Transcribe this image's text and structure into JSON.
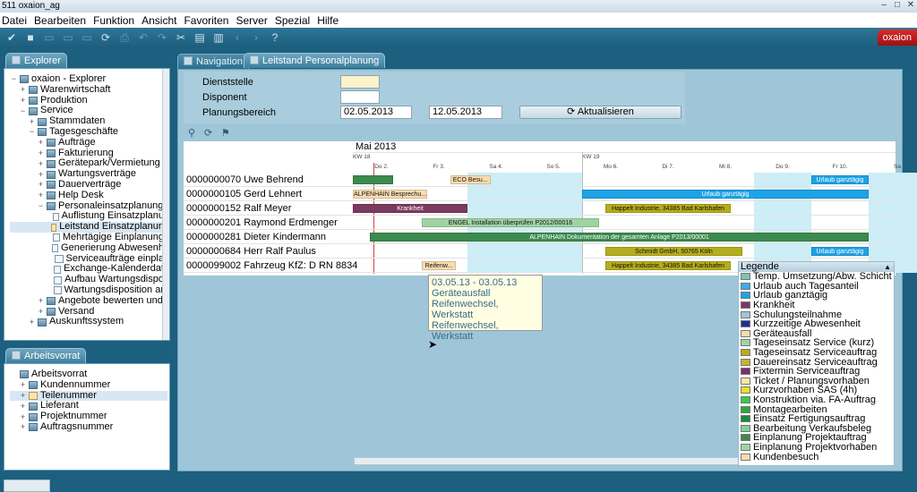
{
  "window": {
    "title": "511 oxaion_ag"
  },
  "menu": [
    "Datei",
    "Bearbeiten",
    "Funktion",
    "Ansicht",
    "Favoriten",
    "Server",
    "Spezial",
    "Hilfe"
  ],
  "brand": "oxaion",
  "explorer": {
    "tab": "Explorer",
    "items": [
      {
        "label": "oxaion - Explorer",
        "level": 0,
        "exp": "-"
      },
      {
        "label": "Warenwirtschaft",
        "level": 1,
        "exp": "+"
      },
      {
        "label": "Produktion",
        "level": 1,
        "exp": "+"
      },
      {
        "label": "Service",
        "level": 1,
        "exp": "-"
      },
      {
        "label": "Stammdaten",
        "level": 2,
        "exp": "+"
      },
      {
        "label": "Tagesgeschäfte",
        "level": 2,
        "exp": "-"
      },
      {
        "label": "Aufträge",
        "level": 3,
        "exp": "+"
      },
      {
        "label": "Fakturierung",
        "level": 3,
        "exp": "+"
      },
      {
        "label": "Gerätepark/Vermietung",
        "level": 3,
        "exp": "+"
      },
      {
        "label": "Wartungsverträge",
        "level": 3,
        "exp": "+"
      },
      {
        "label": "Dauerverträge",
        "level": 3,
        "exp": "+"
      },
      {
        "label": "Help Desk",
        "level": 3,
        "exp": "+"
      },
      {
        "label": "Personaleinsatzplanung",
        "level": 3,
        "exp": "-"
      },
      {
        "label": "Auflistung Einsatzplanu",
        "level": 4,
        "exp": ""
      },
      {
        "label": "Leitstand Einsatzplanun",
        "level": 4,
        "exp": "",
        "selected": true
      },
      {
        "label": "Mehrtägige Einplanung",
        "level": 4,
        "exp": ""
      },
      {
        "label": "Generierung Abwesenh",
        "level": 4,
        "exp": ""
      },
      {
        "label": "Serviceaufträge einpla",
        "level": 4,
        "exp": ""
      },
      {
        "label": "Exchange-Kalenderdat",
        "level": 4,
        "exp": ""
      },
      {
        "label": "Aufbau Wartungsdispo",
        "level": 4,
        "exp": ""
      },
      {
        "label": "Wartungsdisposition ar",
        "level": 4,
        "exp": ""
      },
      {
        "label": "Angebote bewerten und",
        "level": 3,
        "exp": "+"
      },
      {
        "label": "Versand",
        "level": 3,
        "exp": "+"
      },
      {
        "label": "Auskunftssystem",
        "level": 2,
        "exp": "+"
      }
    ]
  },
  "arbeitsvorrat": {
    "tab": "Arbeitsvorrat",
    "items": [
      {
        "label": "Arbeitsvorrat",
        "level": 0,
        "exp": ""
      },
      {
        "label": "Kundennummer",
        "level": 1,
        "exp": "+"
      },
      {
        "label": "Teilenummer",
        "level": 1,
        "exp": "+",
        "selected": true
      },
      {
        "label": "Lieferant",
        "level": 1,
        "exp": "+"
      },
      {
        "label": "Projektnummer",
        "level": 1,
        "exp": "+"
      },
      {
        "label": "Auftragsnummer",
        "level": 1,
        "exp": "+"
      }
    ]
  },
  "tabs": {
    "navigation": "Navigation",
    "leitstand": "Leitstand Personalplanung"
  },
  "form": {
    "dienststelle_label": "Dienststelle",
    "disponent_label": "Disponent",
    "planungsbereich_label": "Planungsbereich",
    "date_from": "02.05.2013",
    "date_to": "12.05.2013",
    "refresh_button": "Aktualisieren"
  },
  "chart_data": {
    "type": "gantt",
    "month": "Mai 2013",
    "weeks": [
      "KW 18",
      "KW 19"
    ],
    "days": [
      "Do 2.",
      "Fr 3.",
      "Sa 4.",
      "So 5.",
      "Mo 6.",
      "Di 7.",
      "Mi 8.",
      "Do 9.",
      "Fr 10.",
      "Sa"
    ],
    "rows": [
      {
        "label": "0000000070 Uwe Behrend",
        "bars": [
          {
            "start": 0,
            "end": 0.7,
            "color": "#3c8a4d",
            "text": ""
          },
          {
            "start": 1.7,
            "end": 2.4,
            "color": "#f9dcb0",
            "text": "ECO  Besu..."
          },
          {
            "start": 8,
            "end": 9,
            "color": "#1ea3e6",
            "text": "Urlaub ganztägig"
          }
        ]
      },
      {
        "label": "0000000105 Gerd Lehnert",
        "bars": [
          {
            "start": 0,
            "end": 1.3,
            "color": "#f9dcb0",
            "text": "ALPENHAIN  Besprechu..."
          },
          {
            "start": 4,
            "end": 9,
            "color": "#1ea3e6",
            "text": "Urlaub ganztägig"
          }
        ]
      },
      {
        "label": "0000000152 Ralf Meyer",
        "bars": [
          {
            "start": 0,
            "end": 2,
            "color": "#7b3a60",
            "text": "Krankheit"
          },
          {
            "start": 4.4,
            "end": 6.6,
            "color": "#b5ae1c",
            "text": "Happelt Industrie, 34385 Bad Karlshafen"
          }
        ]
      },
      {
        "label": "0000000201 Raymond Erdmenger",
        "bars": [
          {
            "start": 1.2,
            "end": 4.3,
            "color": "#9fd4a2",
            "text": "ENGEL  Installation überprüfen P2012/00016"
          }
        ]
      },
      {
        "label": "0000000281 Dieter Kindermann",
        "bars": [
          {
            "start": 0.3,
            "end": 9,
            "color": "#3c8a4d",
            "text": "ALPENHAIN  Dokumentation der gesamten Anlage P2013/00001"
          }
        ]
      },
      {
        "label": "0000000684 Herr Ralf Paulus",
        "bars": [
          {
            "start": 4.4,
            "end": 6.8,
            "color": "#b5ae1c",
            "text": "Schmidt GmbH, 50765 Köln"
          },
          {
            "start": 8,
            "end": 9,
            "color": "#1ea3e6",
            "text": "Urlaub ganztägig"
          }
        ]
      },
      {
        "label": "0000099002 Fahrzeug KfZ: D RN 8834",
        "bars": [
          {
            "start": 1.2,
            "end": 1.8,
            "color": "#f9dcb0",
            "text": "Reifenw..."
          },
          {
            "start": 4.4,
            "end": 6.6,
            "color": "#b5ae1c",
            "text": "Happelt Industrie, 34385 Bad Karlshafen"
          }
        ]
      }
    ]
  },
  "tooltip": [
    "03.05.13 - 03.05.13",
    "Geräteausfall",
    "Reifenwechsel, Werkstatt",
    "",
    "Reifenwechsel, Werkstatt"
  ],
  "legend": {
    "title": "Legende",
    "items": [
      {
        "label": "Temp. Umsetzung/Abw. Schicht",
        "color": "#7fc4b2"
      },
      {
        "label": "Urlaub auch Tagesanteil",
        "color": "#3aaee8"
      },
      {
        "label": "Urlaub ganztägig",
        "color": "#1ea3e6"
      },
      {
        "label": "Krankheit",
        "color": "#7b3a60"
      },
      {
        "label": "Schulungsteilnahme",
        "color": "#a6c3d2"
      },
      {
        "label": "Kurzzeitige Abwesenheit",
        "color": "#1c2f9b"
      },
      {
        "label": "Geräteausfall",
        "color": "#f9dcb0"
      },
      {
        "label": "Tageseinsatz Service (kurz)",
        "color": "#9fd4a2"
      },
      {
        "label": "Tageseinsatz Serviceauftrag",
        "color": "#b5ae1c"
      },
      {
        "label": "Dauereinsatz Serviceauftrag",
        "color": "#c7b52a"
      },
      {
        "label": "Fixtermin Serviceauftrag",
        "color": "#7a2f6a"
      },
      {
        "label": "Ticket / Planungsvorhaben",
        "color": "#f7e7a3"
      },
      {
        "label": "Kurzvorhaben SAS (4h)",
        "color": "#e9e21d"
      },
      {
        "label": "Konstruktion via. FA-Auftrag",
        "color": "#33cf4a"
      },
      {
        "label": "Montagearbeiten",
        "color": "#2fa73b"
      },
      {
        "label": "Einsatz Fertigungsauftrag",
        "color": "#1d8a37"
      },
      {
        "label": "Bearbeitung Verkaufsbeleg",
        "color": "#7fd195"
      },
      {
        "label": "Einplanung Projektauftrag",
        "color": "#3c8a4d"
      },
      {
        "label": "Einplanung Projektvorhaben",
        "color": "#9fd4a2"
      },
      {
        "label": "Kundenbesuch",
        "color": "#f9dcb0"
      }
    ]
  }
}
